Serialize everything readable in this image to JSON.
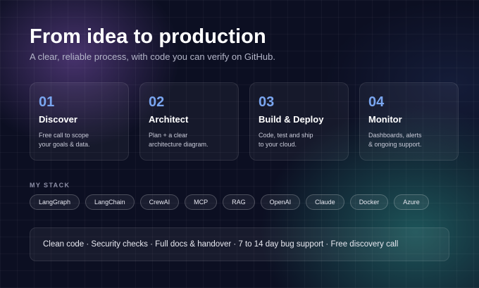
{
  "hero": {
    "title": "From idea to production",
    "subtitle": "A clear, reliable process, with code you can verify on GitHub."
  },
  "steps": [
    {
      "number": "01",
      "title": "Discover",
      "desc_lines": [
        "Free call to scope",
        "your goals & data."
      ]
    },
    {
      "number": "02",
      "title": "Architect",
      "desc_lines": [
        "Plan + a clear",
        "architecture diagram."
      ]
    },
    {
      "number": "03",
      "title": "Build & Deploy",
      "desc_lines": [
        "Code, test and ship",
        "to your cloud."
      ]
    },
    {
      "number": "04",
      "title": "Monitor",
      "desc_lines": [
        "Dashboards, alerts",
        "& ongoing support."
      ]
    }
  ],
  "stack": {
    "label": "MY STACK",
    "items": [
      "LangGraph",
      "LangChain",
      "CrewAI",
      "MCP",
      "RAG",
      "OpenAI",
      "Claude",
      "Docker",
      "Azure"
    ]
  },
  "banner": {
    "text": "Clean code · Security checks · Full docs & handover · 7 to 14 day bug support · Free discovery call"
  },
  "colors": {
    "background": "#0c0f22",
    "accent_number": "#7aa6f0",
    "glow_purple": "#7850aa",
    "glow_teal": "#28827d"
  }
}
